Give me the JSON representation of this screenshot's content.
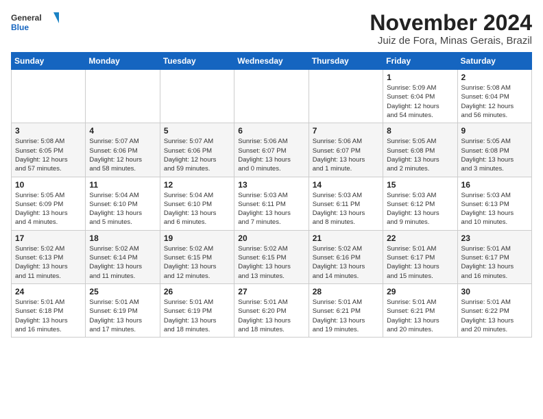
{
  "header": {
    "logo_line1": "General",
    "logo_line2": "Blue",
    "month": "November 2024",
    "location": "Juiz de Fora, Minas Gerais, Brazil"
  },
  "weekdays": [
    "Sunday",
    "Monday",
    "Tuesday",
    "Wednesday",
    "Thursday",
    "Friday",
    "Saturday"
  ],
  "weeks": [
    [
      {
        "day": "",
        "info": ""
      },
      {
        "day": "",
        "info": ""
      },
      {
        "day": "",
        "info": ""
      },
      {
        "day": "",
        "info": ""
      },
      {
        "day": "",
        "info": ""
      },
      {
        "day": "1",
        "info": "Sunrise: 5:09 AM\nSunset: 6:04 PM\nDaylight: 12 hours\nand 54 minutes."
      },
      {
        "day": "2",
        "info": "Sunrise: 5:08 AM\nSunset: 6:04 PM\nDaylight: 12 hours\nand 56 minutes."
      }
    ],
    [
      {
        "day": "3",
        "info": "Sunrise: 5:08 AM\nSunset: 6:05 PM\nDaylight: 12 hours\nand 57 minutes."
      },
      {
        "day": "4",
        "info": "Sunrise: 5:07 AM\nSunset: 6:06 PM\nDaylight: 12 hours\nand 58 minutes."
      },
      {
        "day": "5",
        "info": "Sunrise: 5:07 AM\nSunset: 6:06 PM\nDaylight: 12 hours\nand 59 minutes."
      },
      {
        "day": "6",
        "info": "Sunrise: 5:06 AM\nSunset: 6:07 PM\nDaylight: 13 hours\nand 0 minutes."
      },
      {
        "day": "7",
        "info": "Sunrise: 5:06 AM\nSunset: 6:07 PM\nDaylight: 13 hours\nand 1 minute."
      },
      {
        "day": "8",
        "info": "Sunrise: 5:05 AM\nSunset: 6:08 PM\nDaylight: 13 hours\nand 2 minutes."
      },
      {
        "day": "9",
        "info": "Sunrise: 5:05 AM\nSunset: 6:08 PM\nDaylight: 13 hours\nand 3 minutes."
      }
    ],
    [
      {
        "day": "10",
        "info": "Sunrise: 5:05 AM\nSunset: 6:09 PM\nDaylight: 13 hours\nand 4 minutes."
      },
      {
        "day": "11",
        "info": "Sunrise: 5:04 AM\nSunset: 6:10 PM\nDaylight: 13 hours\nand 5 minutes."
      },
      {
        "day": "12",
        "info": "Sunrise: 5:04 AM\nSunset: 6:10 PM\nDaylight: 13 hours\nand 6 minutes."
      },
      {
        "day": "13",
        "info": "Sunrise: 5:03 AM\nSunset: 6:11 PM\nDaylight: 13 hours\nand 7 minutes."
      },
      {
        "day": "14",
        "info": "Sunrise: 5:03 AM\nSunset: 6:11 PM\nDaylight: 13 hours\nand 8 minutes."
      },
      {
        "day": "15",
        "info": "Sunrise: 5:03 AM\nSunset: 6:12 PM\nDaylight: 13 hours\nand 9 minutes."
      },
      {
        "day": "16",
        "info": "Sunrise: 5:03 AM\nSunset: 6:13 PM\nDaylight: 13 hours\nand 10 minutes."
      }
    ],
    [
      {
        "day": "17",
        "info": "Sunrise: 5:02 AM\nSunset: 6:13 PM\nDaylight: 13 hours\nand 11 minutes."
      },
      {
        "day": "18",
        "info": "Sunrise: 5:02 AM\nSunset: 6:14 PM\nDaylight: 13 hours\nand 11 minutes."
      },
      {
        "day": "19",
        "info": "Sunrise: 5:02 AM\nSunset: 6:15 PM\nDaylight: 13 hours\nand 12 minutes."
      },
      {
        "day": "20",
        "info": "Sunrise: 5:02 AM\nSunset: 6:15 PM\nDaylight: 13 hours\nand 13 minutes."
      },
      {
        "day": "21",
        "info": "Sunrise: 5:02 AM\nSunset: 6:16 PM\nDaylight: 13 hours\nand 14 minutes."
      },
      {
        "day": "22",
        "info": "Sunrise: 5:01 AM\nSunset: 6:17 PM\nDaylight: 13 hours\nand 15 minutes."
      },
      {
        "day": "23",
        "info": "Sunrise: 5:01 AM\nSunset: 6:17 PM\nDaylight: 13 hours\nand 16 minutes."
      }
    ],
    [
      {
        "day": "24",
        "info": "Sunrise: 5:01 AM\nSunset: 6:18 PM\nDaylight: 13 hours\nand 16 minutes."
      },
      {
        "day": "25",
        "info": "Sunrise: 5:01 AM\nSunset: 6:19 PM\nDaylight: 13 hours\nand 17 minutes."
      },
      {
        "day": "26",
        "info": "Sunrise: 5:01 AM\nSunset: 6:19 PM\nDaylight: 13 hours\nand 18 minutes."
      },
      {
        "day": "27",
        "info": "Sunrise: 5:01 AM\nSunset: 6:20 PM\nDaylight: 13 hours\nand 18 minutes."
      },
      {
        "day": "28",
        "info": "Sunrise: 5:01 AM\nSunset: 6:21 PM\nDaylight: 13 hours\nand 19 minutes."
      },
      {
        "day": "29",
        "info": "Sunrise: 5:01 AM\nSunset: 6:21 PM\nDaylight: 13 hours\nand 20 minutes."
      },
      {
        "day": "30",
        "info": "Sunrise: 5:01 AM\nSunset: 6:22 PM\nDaylight: 13 hours\nand 20 minutes."
      }
    ]
  ]
}
